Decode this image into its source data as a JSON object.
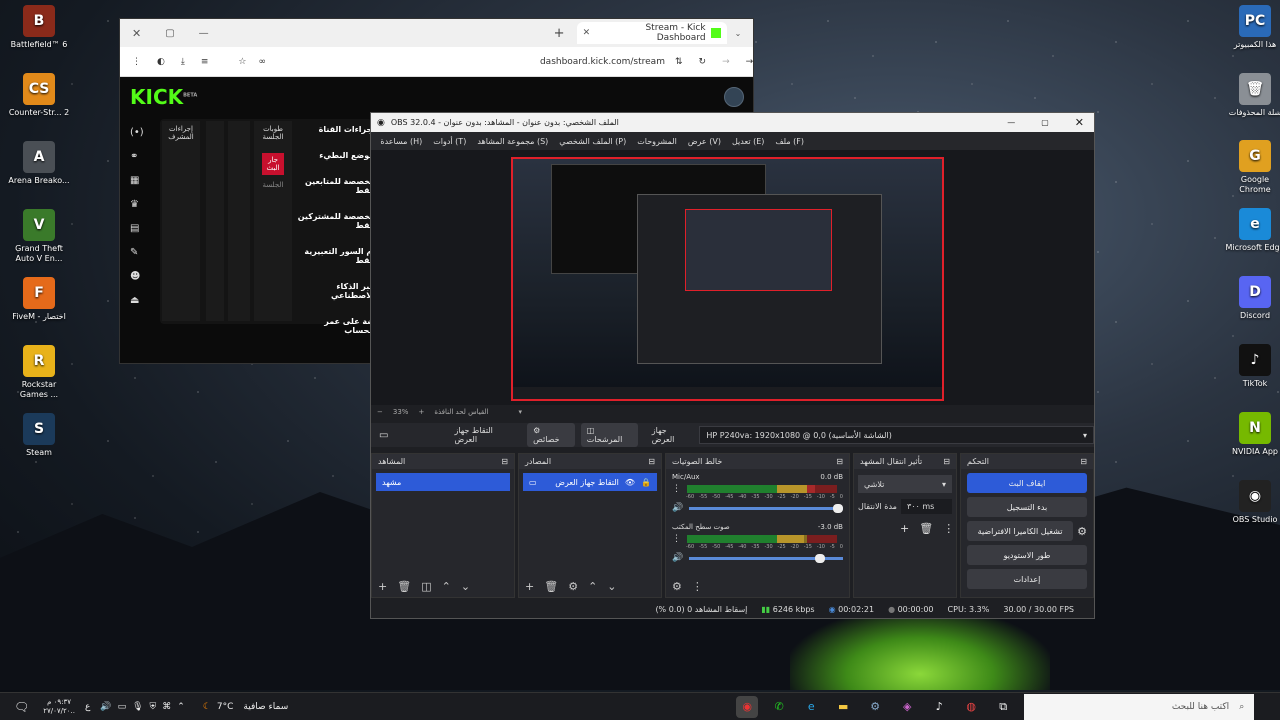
{
  "desktop": {
    "left_icons": [
      {
        "label": "Battlefield™ 6",
        "color": "#8a2a1a",
        "glyph": "B"
      },
      {
        "label": "Counter-Str... 2",
        "color": "#e28a1a",
        "glyph": "CS"
      },
      {
        "label": "Arena Breako...",
        "color": "#4a4f55",
        "glyph": "A"
      },
      {
        "label": "Grand Theft Auto V En...",
        "color": "#3a7a2a",
        "glyph": "V"
      },
      {
        "label": "FiveM - اختصار",
        "color": "#e56a1a",
        "glyph": "F"
      },
      {
        "label": "Rockstar Games ...",
        "color": "#e8b21a",
        "glyph": "R"
      },
      {
        "label": "Steam",
        "color": "#1b3a5a",
        "glyph": "S"
      }
    ],
    "right_icons": [
      {
        "label": "هذا الكمبيوتر",
        "color": "#2a6ab8",
        "glyph": "PC"
      },
      {
        "label": "سلة المحذوفات",
        "color": "#8a8f95",
        "glyph": "🗑"
      },
      {
        "label": "Google Chrome",
        "color": "#e0a020",
        "glyph": "G"
      },
      {
        "label": "Microsoft Edge",
        "color": "#1a8ad8",
        "glyph": "e"
      },
      {
        "label": "Discord",
        "color": "#5865f2",
        "glyph": "D"
      },
      {
        "label": "TikTok",
        "color": "#111",
        "glyph": "♪"
      },
      {
        "label": "NVIDIA App",
        "color": "#76b900",
        "glyph": "N"
      },
      {
        "label": "OBS Studio",
        "color": "#222",
        "glyph": "◉"
      }
    ]
  },
  "browser": {
    "tab_title": "Stream - Kick Dashboard",
    "url": "dashboard.kick.com/stream",
    "logo": "KICK",
    "logo_sup": "BETA",
    "menu_items": [
      "إجراءات القناة",
      "الوضع البطيء",
      "مخصصة للمتابعين فقط",
      "مخصصة للمشتركين فقط",
      "إم السور التعبيرية فقط",
      "عبر الذكاء الاصطناعي",
      "ضة على عمر الحساب"
    ],
    "col_headers": [
      "طوبات الجلسة",
      "إجراءات المشرف"
    ],
    "badge": "جار البث",
    "session": "الجلسة"
  },
  "obs": {
    "title": "OBS 32.0.4 - الملف الشخصي: بدون عنوان - المشاهد: بدون عنوان",
    "menu": [
      "ملف (F)",
      "تعديل (E)",
      "عرض (V)",
      "المشروحات",
      "الملف الشخصي (P)",
      "مجموعة المشاهد (S)",
      "أدوات (T)",
      "مساعدة (H)"
    ],
    "zoom": "33%",
    "zoom_label": "القياس لحد النافذة",
    "source_toolbar": {
      "source_name": "التقاط جهاز العرض",
      "properties": "خصائص",
      "filters": "المرشحات",
      "display_label": "جهاز العرض",
      "display_value": "HP P240va: 1920x1080 @ 0,0 (الشاشة الأساسية)"
    },
    "scenes": {
      "title": "المشاهد",
      "items": [
        "مشهد"
      ]
    },
    "sources": {
      "title": "المصادر",
      "items": [
        "التقاط جهاز العرض"
      ]
    },
    "mixer": {
      "title": "خالط الصوتيات",
      "channels": [
        {
          "name": "Mic/Aux",
          "db": "0.0 dB",
          "level": 0.85
        },
        {
          "name": "صوت سطح المكتب",
          "db": "-3.0 dB",
          "level": 0.78
        }
      ],
      "ticks": [
        "-60",
        "-55",
        "-50",
        "-45",
        "-40",
        "-35",
        "-30",
        "-25",
        "-20",
        "-15",
        "-10",
        "-5",
        "0"
      ]
    },
    "transitions": {
      "title": "تأثير انتقال المشهد",
      "type": "تلاشي",
      "duration_label": "مدة الانتقال",
      "duration": "٣٠٠ ms"
    },
    "controls": {
      "title": "التحكم",
      "buttons": [
        "ايقاف البث",
        "بدء التسجيل",
        "تشغيل الكاميرا الافتراضية",
        "طور الاستوديو",
        "إعدادات"
      ]
    },
    "status": {
      "dropped": "إسقاط المشاهد 0 (0.0 %)",
      "bitrate": "6246 kbps",
      "stream_time": "00:02:21",
      "rec_time": "00:00:00",
      "cpu": "CPU: 3.3%",
      "fps": "30.00 / 30.00 FPS"
    }
  },
  "taskbar": {
    "search_placeholder": "اكتب هنا للبحث",
    "weather": "سماء صافية",
    "temp": "7°C",
    "time": "٠٩:٣٧ م",
    "date": "٢٧/٠٧/٢٠..",
    "lang": "ع"
  }
}
